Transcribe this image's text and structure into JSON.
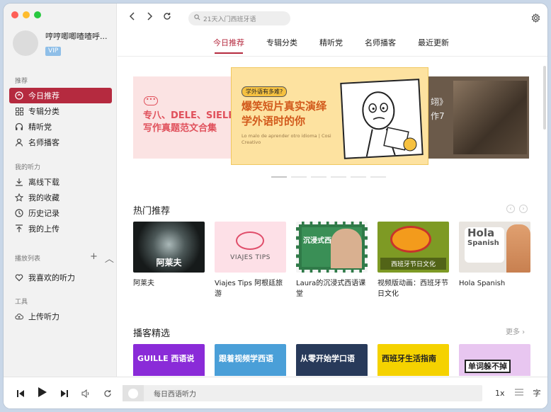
{
  "window": {
    "traffic_colors": [
      "#fe5f57",
      "#febc2e",
      "#28c840"
    ]
  },
  "profile": {
    "username": "哼哼唧唧喳喳呼...",
    "badge": "VIP"
  },
  "sidebar": {
    "sections": [
      {
        "title": "推荐"
      },
      {
        "title": "我的听力"
      },
      {
        "title": "播放列表"
      },
      {
        "title": "工具"
      }
    ],
    "recommend": [
      {
        "label": "今日推荐",
        "icon": "today-icon",
        "active": true
      },
      {
        "label": "专辑分类",
        "icon": "grid-icon"
      },
      {
        "label": "精听党",
        "icon": "headphones-icon"
      },
      {
        "label": "名师播客",
        "icon": "user-icon"
      }
    ],
    "my_listening": [
      {
        "label": "离线下载",
        "icon": "download-icon"
      },
      {
        "label": "我的收藏",
        "icon": "star-icon"
      },
      {
        "label": "历史记录",
        "icon": "clock-icon"
      },
      {
        "label": "我的上传",
        "icon": "upload-icon"
      }
    ],
    "playlist": [
      {
        "label": "我喜欢的听力",
        "icon": "heart-icon"
      }
    ],
    "tools": [
      {
        "label": "上传听力",
        "icon": "cloud-upload-icon"
      }
    ],
    "playlist_add": "+",
    "playlist_collapse": "︿"
  },
  "toolbar": {
    "search_placeholder": "21天入门西班牙语"
  },
  "tabs": [
    {
      "label": "今日推荐",
      "active": true
    },
    {
      "label": "专辑分类"
    },
    {
      "label": "精听党"
    },
    {
      "label": "名师播客"
    },
    {
      "label": "最近更新"
    }
  ],
  "banner": {
    "left": {
      "line1": "专八、DELE、SIELE",
      "line2": "写作真题范文合集",
      "bubble": "•••"
    },
    "center": {
      "tag": "学外语有多难?",
      "title_line1": "爆笑短片真实演绎",
      "title_line2": "学外语时的你",
      "subtitle": "Lo malo de aprender otro idioma | Cosi Creativo"
    },
    "right": {
      "line1": "翊》",
      "line2": "作7"
    },
    "dots": 6,
    "active_dot": 0
  },
  "hot": {
    "title": "热门推荐",
    "cards": [
      {
        "title": "阿莱夫",
        "thumb_label": "阿莱夫"
      },
      {
        "title": "Viajes Tips 阿根廷旅游",
        "thumb_label": "VIAJES TIPS"
      },
      {
        "title": "Laura的沉浸式西语课堂",
        "thumb_label": "沉浸式西语课堂"
      },
      {
        "title": "视频版动画：西班牙节日文化",
        "thumb_label": "西班牙节日文化"
      },
      {
        "title": "Hola Spanish",
        "thumb_label_1": "Hola",
        "thumb_label_2": "Spanish"
      }
    ]
  },
  "podcasts": {
    "title": "播客精选",
    "more": "更多 ›",
    "cards": [
      {
        "thumb_label": "GUILLE 西语说"
      },
      {
        "thumb_label": "跟着视频学西语"
      },
      {
        "thumb_label": "从零开始学口语"
      },
      {
        "thumb_label": "西班牙生活指南"
      },
      {
        "thumb_label": "单词躲不掉"
      }
    ]
  },
  "player": {
    "now_playing": "每日西语听力",
    "speed": "1x",
    "lyrics": "字"
  }
}
